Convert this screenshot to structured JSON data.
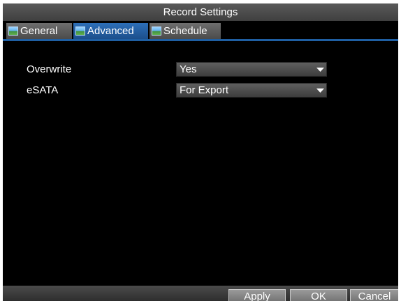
{
  "window": {
    "title": "Record Settings"
  },
  "tabs": [
    {
      "label": "General",
      "icon": "picture-icon",
      "active": false
    },
    {
      "label": "Advanced",
      "icon": "picture-icon",
      "active": true
    },
    {
      "label": "Schedule",
      "icon": "picture-icon",
      "active": false
    }
  ],
  "settings": {
    "overwrite": {
      "label": "Overwrite",
      "value": "Yes"
    },
    "esata": {
      "label": "eSATA",
      "value": "For Export"
    }
  },
  "buttons": {
    "apply": "Apply",
    "ok": "OK",
    "cancel": "Cancel"
  },
  "colors": {
    "background": "#000000",
    "active_tab": "#2d6fb8",
    "tab_rule": "#1f5fa3"
  }
}
